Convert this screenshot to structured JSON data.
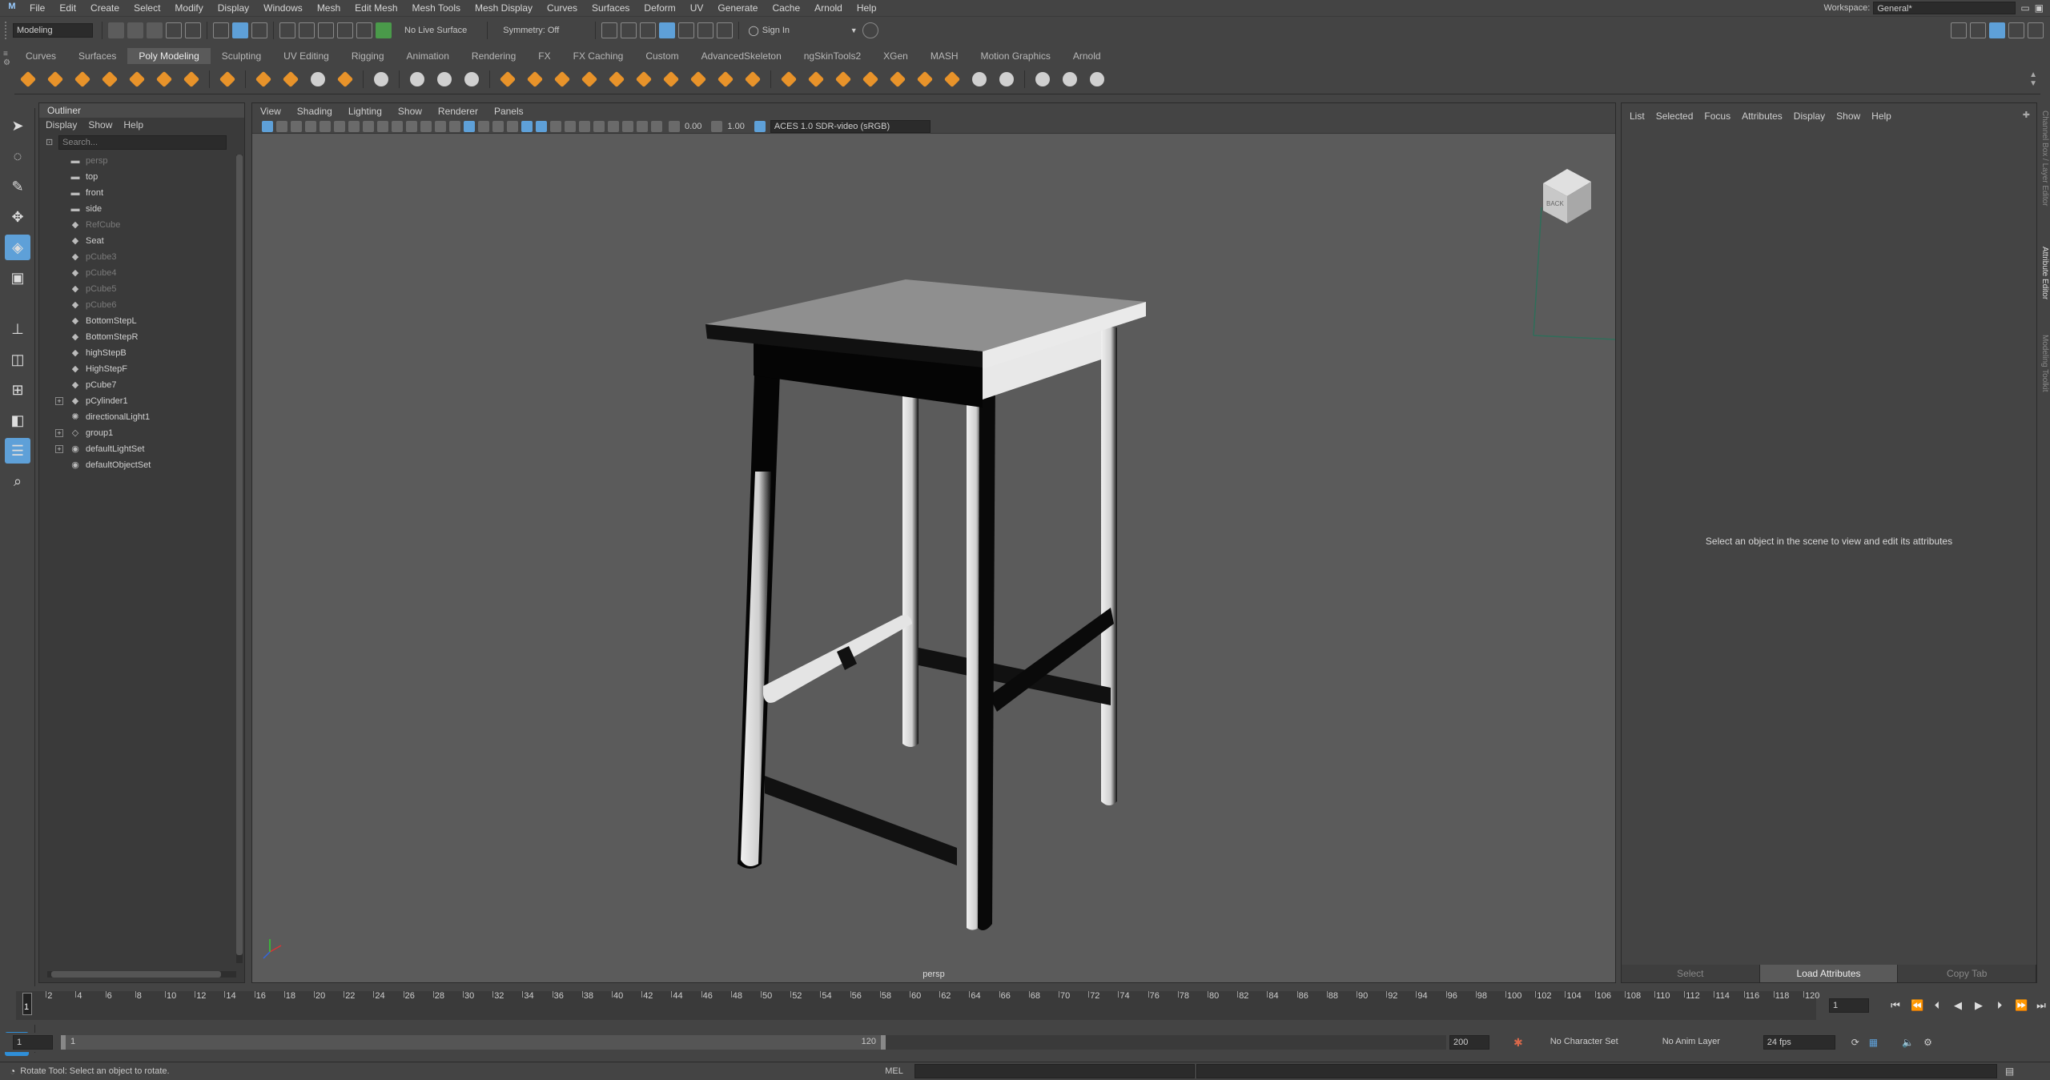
{
  "menubar": {
    "items": [
      "File",
      "Edit",
      "Create",
      "Select",
      "Modify",
      "Display",
      "Windows",
      "Mesh",
      "Edit Mesh",
      "Mesh Tools",
      "Mesh Display",
      "Curves",
      "Surfaces",
      "Deform",
      "UV",
      "Generate",
      "Cache",
      "Arnold",
      "Help"
    ],
    "workspace_label": "Workspace:",
    "workspace_value": "General*"
  },
  "statusline": {
    "menuset": "Modeling",
    "live_surface": "No Live Surface",
    "symmetry": "Symmetry: Off",
    "sign_in": "Sign In"
  },
  "shelf": {
    "tabs": [
      "Curves",
      "Surfaces",
      "Poly Modeling",
      "Sculpting",
      "UV Editing",
      "Rigging",
      "Animation",
      "Rendering",
      "FX",
      "FX Caching",
      "Custom",
      "AdvancedSkeleton",
      "ngSkinTools2",
      "XGen",
      "MASH",
      "Motion Graphics",
      "Arnold"
    ],
    "active_tab": "Poly Modeling"
  },
  "outliner": {
    "title": "Outliner",
    "menu": [
      "Display",
      "Show",
      "Help"
    ],
    "search_placeholder": "Search...",
    "items": [
      {
        "label": "persp",
        "icon": "camera-icon",
        "dim": true,
        "expand": false
      },
      {
        "label": "top",
        "icon": "camera-icon",
        "dim": false,
        "expand": false
      },
      {
        "label": "front",
        "icon": "camera-icon",
        "dim": false,
        "expand": false
      },
      {
        "label": "side",
        "icon": "camera-icon",
        "dim": false,
        "expand": false
      },
      {
        "label": "RefCube",
        "icon": "mesh-icon",
        "dim": true,
        "expand": false
      },
      {
        "label": "Seat",
        "icon": "mesh-icon",
        "dim": false,
        "expand": false
      },
      {
        "label": "pCube3",
        "icon": "mesh-icon",
        "dim": true,
        "expand": false
      },
      {
        "label": "pCube4",
        "icon": "mesh-icon",
        "dim": true,
        "expand": false
      },
      {
        "label": "pCube5",
        "icon": "mesh-icon",
        "dim": true,
        "expand": false
      },
      {
        "label": "pCube6",
        "icon": "mesh-icon",
        "dim": true,
        "expand": false
      },
      {
        "label": "BottomStepL",
        "icon": "mesh-icon",
        "dim": false,
        "expand": false
      },
      {
        "label": "BottomStepR",
        "icon": "mesh-icon",
        "dim": false,
        "expand": false
      },
      {
        "label": "highStepB",
        "icon": "mesh-icon",
        "dim": false,
        "expand": false
      },
      {
        "label": "HighStepF",
        "icon": "mesh-icon",
        "dim": false,
        "expand": false
      },
      {
        "label": "pCube7",
        "icon": "mesh-icon",
        "dim": false,
        "expand": false
      },
      {
        "label": "pCylinder1",
        "icon": "mesh-icon",
        "dim": false,
        "expand": true
      },
      {
        "label": "directionalLight1",
        "icon": "light-icon",
        "dim": false,
        "expand": false
      },
      {
        "label": "group1",
        "icon": "group-icon",
        "dim": false,
        "expand": true
      },
      {
        "label": "defaultLightSet",
        "icon": "set-icon",
        "dim": false,
        "expand": true
      },
      {
        "label": "defaultObjectSet",
        "icon": "set-icon",
        "dim": false,
        "expand": false
      }
    ]
  },
  "viewport": {
    "menu": [
      "View",
      "Shading",
      "Lighting",
      "Show",
      "Renderer",
      "Panels"
    ],
    "exposure": "0.00",
    "gamma": "1.00",
    "color_space": "ACES 1.0 SDR-video (sRGB)",
    "camera_label": "persp",
    "viewcube_label": "BACK"
  },
  "attribute_editor": {
    "menu": [
      "List",
      "Selected",
      "Focus",
      "Attributes",
      "Display",
      "Show",
      "Help"
    ],
    "message": "Select an object in the scene to view and edit its attributes",
    "buttons": [
      "Select",
      "Load Attributes",
      "Copy Tab"
    ]
  },
  "side_tabs": [
    "Channel Box / Layer Editor",
    "Attribute Editor",
    "Modeling Toolkit"
  ],
  "timeline": {
    "ticks": [
      2,
      4,
      6,
      8,
      10,
      12,
      14,
      16,
      18,
      20,
      22,
      24,
      26,
      28,
      30,
      32,
      34,
      36,
      38,
      40,
      42,
      44,
      46,
      48,
      50,
      52,
      54,
      56,
      58,
      60,
      62,
      64,
      66,
      68,
      70,
      72,
      74,
      76,
      78,
      80,
      82,
      84,
      86,
      88,
      90,
      92,
      94,
      96,
      98,
      100,
      102,
      104,
      106,
      108,
      110,
      112,
      114,
      116,
      118,
      120
    ],
    "range_max": 120,
    "current_frame": "1",
    "current_frame_field": "1"
  },
  "range": {
    "start": "1",
    "inner_start": "1",
    "inner_end": "120",
    "end": "200",
    "character_set": "No Character Set",
    "anim_layer": "No Anim Layer",
    "fps": "24 fps"
  },
  "status": {
    "help_text": "Rotate Tool: Select an object to rotate.",
    "command_lang": "MEL"
  }
}
